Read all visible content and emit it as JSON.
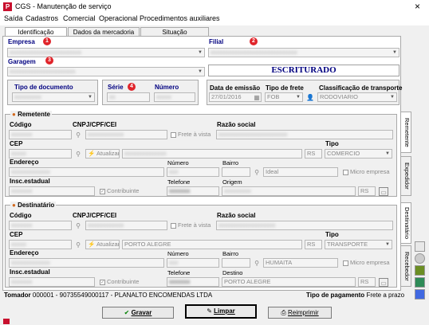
{
  "window": {
    "title": "CGS - Manutenção de serviço",
    "close": "×"
  },
  "menu": [
    "Saída",
    "Cadastros",
    "Comercial",
    "Operacional",
    "Procedimentos auxiliares"
  ],
  "tabs": [
    "Identificação",
    "Dados da mercadoria",
    "Situação"
  ],
  "top": {
    "empresa_label": "Empresa",
    "filial_label": "Filial",
    "garagem_label": "Garagem",
    "status": "ESCRITURADO",
    "tipo_doc_label": "Tipo de documento",
    "serie_label": "Série",
    "numero_label": "Número",
    "data_emissao_label": "Data de emissão",
    "data_emissao": "27/01/2016",
    "tipo_frete_label": "Tipo de frete",
    "tipo_frete": "FOB",
    "classificacao_label": "Classificação de transporte",
    "classificacao": "RODOVIARIO",
    "badges": [
      "1",
      "2",
      "3",
      "4"
    ]
  },
  "remetente": {
    "title": "Remetente",
    "codigo_label": "Código",
    "cnpj_label": "CNPJ/CPF/CEI",
    "frete_vista": "Frete à vista",
    "razao_label": "Razão social",
    "cep_label": "CEP",
    "atualizar": "Atualizar",
    "uf": "RS",
    "tipo_label": "Tipo",
    "tipo": "COMERCIO",
    "endereco_label": "Endereço",
    "numero_label": "Número",
    "bairro_label": "Bairro",
    "bairro": "Ideal",
    "micro": "Micro empresa",
    "insc_label": "Insc.estadual",
    "contribuinte": "Contribuinte",
    "telefone_label": "Telefone",
    "origem_label": "Origem",
    "origem_uf": "RS"
  },
  "destinatario": {
    "title": "Destinatário",
    "codigo_label": "Código",
    "cnpj_label": "CNPJ/CPF/CEI",
    "frete_vista": "Frete à vista",
    "razao_label": "Razão social",
    "cep_label": "CEP",
    "atualizar": "Atualizar",
    "cidade": "PORTO ALEGRE",
    "uf": "RS",
    "tipo_label": "Tipo",
    "tipo": "TRANSPORTE",
    "endereco_label": "Endereço",
    "numero_label": "Número",
    "bairro_label": "Bairro",
    "bairro": "HUMAITA",
    "micro": "Micro empresa",
    "insc_label": "Insc.estadual",
    "contribuinte": "Contribuinte",
    "telefone_label": "Telefone",
    "destino_label": "Destino",
    "destino": "PORTO ALEGRE",
    "destino_uf": "RS"
  },
  "side_tabs": [
    "Remetente",
    "Expedidor",
    "Destinatário",
    "Recebedor"
  ],
  "footer": {
    "tomador_label": "Tomador",
    "tomador": "000001 - 90735549000117 - PLANALTO ENCOMENDAS LTDA",
    "pagamento_label": "Tipo de pagamento",
    "pagamento": "Frete a prazo"
  },
  "buttons": {
    "gravar": "Gravar",
    "limpar": "Limpar",
    "reimprimir": "Reimprimir"
  }
}
